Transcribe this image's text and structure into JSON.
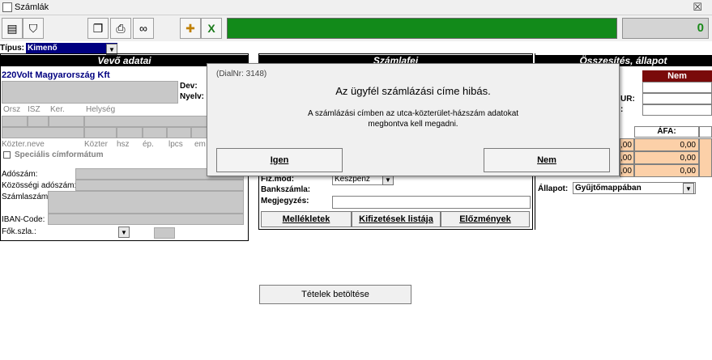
{
  "window": {
    "title": "Számlák",
    "close_glyph": "☒"
  },
  "toolbar": {
    "counter": "0",
    "icons": [
      "view-icon",
      "filter-icon",
      "copy-icon",
      "print-icon",
      "preview-icon",
      "add-icon",
      "excel-icon"
    ]
  },
  "tipus": {
    "label": "Típus:",
    "value": "Kimenő"
  },
  "vevo": {
    "header": "Vevő adatai",
    "name": "220Volt Magyarország Kft",
    "dev_label": "Dev:",
    "nyelv_label": "Nyelv:",
    "addr_cols": [
      "Orsz",
      "ISZ",
      "Ker.",
      "Helység"
    ],
    "street_cols": [
      "Közter.neve",
      "Közter",
      "hsz",
      "ép.",
      "lpcs",
      "em"
    ],
    "special_label": "Speciális címformátum",
    "adoszam_label": "Adószám:",
    "kozossegi_label": "Közösségi adószám:",
    "szamlaszam_label": "Számlaszám:",
    "iban_label": "IBAN-Code:",
    "fok_label": "Fők.szla.:"
  },
  "szamlafej": {
    "header": "Számlafej",
    "fizmod_label": "Fiz.mód:",
    "fizmod_value": "Készpénz",
    "bankszamla_label": "Bankszámla:",
    "megjegyzes_label": "Megjegyzés:",
    "buttons": {
      "mellekletek": "Mellékletek",
      "kifizetesek": "Kifizetések listája",
      "elozmenyek": "Előzmények"
    }
  },
  "osszesites": {
    "header": "Összesítés, állapot",
    "nem_badge": "Nem",
    "eur_label": "UR:",
    "afa_header": "ÁFA:",
    "values": [
      ",00",
      "0,00",
      ",00",
      "0,00",
      ",00",
      "0,00"
    ],
    "allapot_label": "Állapot:",
    "allapot_value": "Gyűjtőmappában"
  },
  "tetelek_button": "Tételek betöltése",
  "dialog": {
    "title": "(DialNr: 3148)",
    "heading": "Az ügyfél számlázási címe hibás.",
    "message_line1": "A számlázási címben az utca-közterület-házszám adatokat",
    "message_line2": "megbontva kell megadni.",
    "yes": "Igen",
    "no": "Nem"
  }
}
